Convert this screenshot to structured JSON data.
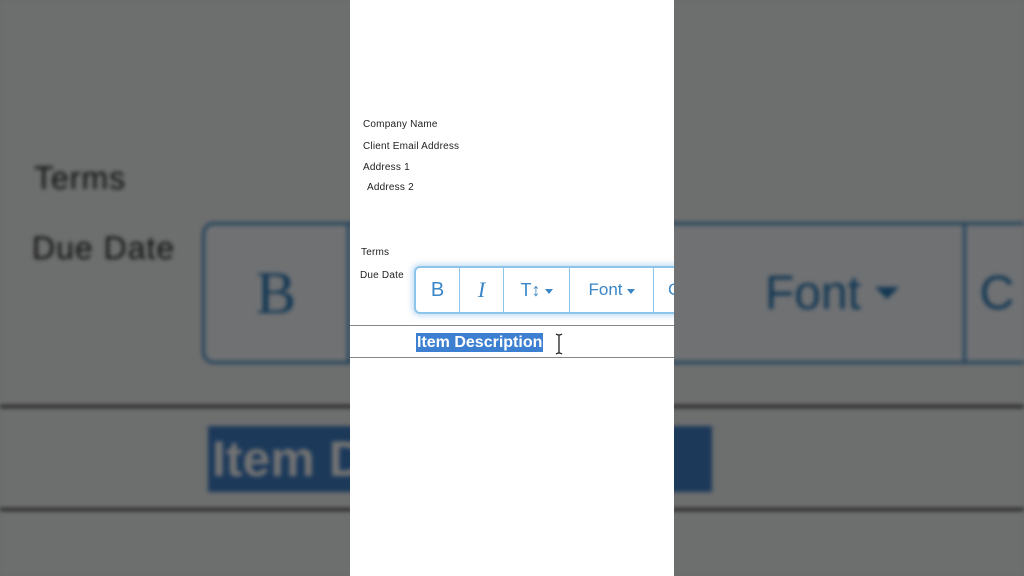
{
  "invoice": {
    "company_name": "Company Name",
    "client_email": "Client Email Address",
    "address_1": "Address 1",
    "address_2": "Address 2",
    "terms": "Terms",
    "due_date": "Due Date",
    "item_description": "Item Description"
  },
  "toolbar": {
    "bold_label": "B",
    "italic_label": "I",
    "size_label": "T↕",
    "font_label": "Font",
    "more_label": "C"
  },
  "icons": {
    "text_cursor": "text-cursor-icon",
    "dropdown": "caret-down-icon"
  },
  "colors": {
    "accent": "#3a86c6",
    "selection": "#3d7fd0",
    "toolbar_border": "#8cc4ea"
  }
}
